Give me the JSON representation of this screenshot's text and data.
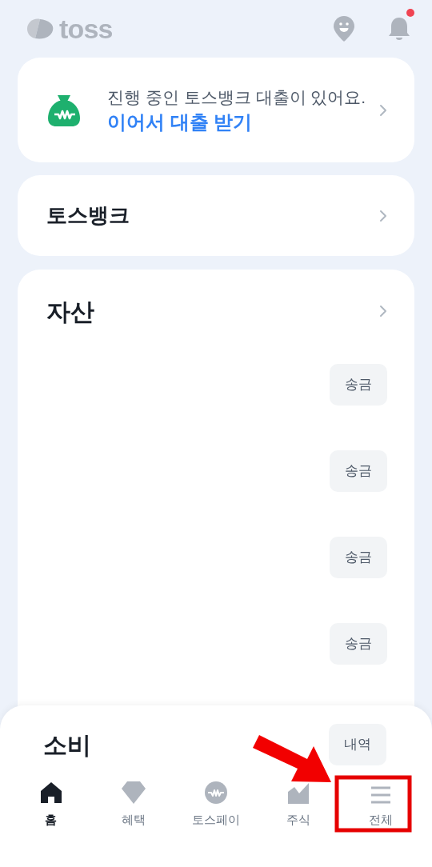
{
  "header": {
    "logo": "toss",
    "notification_dot": true
  },
  "loan_card": {
    "line": "진행 중인 토스뱅크 대출이 있어요.",
    "action": "이어서 대출 받기"
  },
  "bank_card": {
    "title": "토스뱅크"
  },
  "assets": {
    "title": "자산",
    "rows": [
      {
        "button": "송금"
      },
      {
        "button": "송금"
      },
      {
        "button": "송금"
      },
      {
        "button": "송금"
      }
    ]
  },
  "spending": {
    "title": "소비",
    "button": "내역"
  },
  "nav": [
    {
      "label": "홈",
      "kind": "home",
      "selected": true
    },
    {
      "label": "혜택",
      "kind": "gem",
      "selected": false
    },
    {
      "label": "토스페이",
      "kind": "coin",
      "selected": false
    },
    {
      "label": "주식",
      "kind": "chart",
      "selected": false
    },
    {
      "label": "전체",
      "kind": "menu",
      "selected": false
    }
  ]
}
